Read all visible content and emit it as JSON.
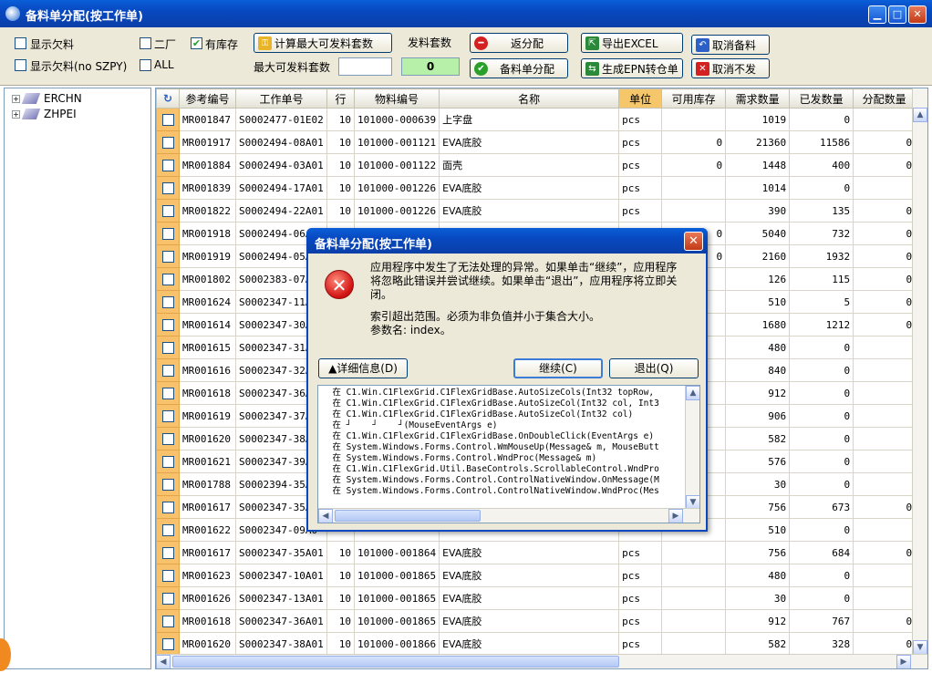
{
  "window": {
    "title": "备料单分配(按工作单)"
  },
  "controls": {
    "show_shortage": "显示欠料",
    "show_shortage_no_szpy": "显示欠料(no SZPY)",
    "factory2": "二厂",
    "all": "ALL",
    "in_stock": "有库存",
    "calc_max": "计算最大可发料套数",
    "issue_sets_label": "发料套数",
    "max_sets_label": "最大可发料套数",
    "max_sets_value": "",
    "issue_sets_value": "0",
    "return_alloc": "返分配",
    "material_alloc": "备料单分配",
    "export_excel": "导出EXCEL",
    "gen_epn": "生成EPN转仓单",
    "cancel_material": "取消备料",
    "cancel_issue": "取消不发"
  },
  "tree": [
    {
      "label": "ERCHN"
    },
    {
      "label": "ZHPEI"
    }
  ],
  "grid": {
    "headers": [
      "参考编号",
      "工作单号",
      "行",
      "物料编号",
      "名称",
      "单位",
      "可用库存",
      "需求数量",
      "已发数量",
      "分配数量"
    ],
    "rows": [
      [
        "MR001847",
        "S0002477-01E02",
        "10",
        "101000-000639",
        "上字盘",
        "pcs",
        "",
        "1019",
        "0",
        ""
      ],
      [
        "MR001917",
        "S0002494-08A01",
        "10",
        "101000-001121",
        "EVA底胶",
        "pcs",
        "0",
        "21360",
        "11586",
        "0"
      ],
      [
        "MR001884",
        "S0002494-03A01",
        "10",
        "101000-001122",
        "面壳",
        "pcs",
        "0",
        "1448",
        "400",
        "0"
      ],
      [
        "MR001839",
        "S0002494-17A01",
        "10",
        "101000-001226",
        "EVA底胶",
        "pcs",
        "",
        "1014",
        "0",
        ""
      ],
      [
        "MR001822",
        "S0002494-22A01",
        "10",
        "101000-001226",
        "EVA底胶",
        "pcs",
        "",
        "390",
        "135",
        "0"
      ],
      [
        "MR001918",
        "S0002494-06A0",
        "",
        "",
        "",
        "",
        "0",
        "5040",
        "732",
        "0"
      ],
      [
        "MR001919",
        "S0002494-05A0",
        "",
        "",
        "",
        "",
        "0",
        "2160",
        "1932",
        "0"
      ],
      [
        "MR001802",
        "S0002383-07A0",
        "",
        "",
        "",
        "",
        "",
        "126",
        "115",
        "0"
      ],
      [
        "MR001624",
        "S0002347-11A0",
        "",
        "",
        "",
        "",
        "",
        "510",
        "5",
        "0"
      ],
      [
        "MR001614",
        "S0002347-30A0",
        "",
        "",
        "",
        "",
        "",
        "1680",
        "1212",
        "0"
      ],
      [
        "MR001615",
        "S0002347-31A0",
        "",
        "",
        "",
        "",
        "",
        "480",
        "0",
        ""
      ],
      [
        "MR001616",
        "S0002347-32A0",
        "",
        "",
        "",
        "",
        "",
        "840",
        "0",
        ""
      ],
      [
        "MR001618",
        "S0002347-36A0",
        "",
        "",
        "",
        "",
        "",
        "912",
        "0",
        ""
      ],
      [
        "MR001619",
        "S0002347-37A0",
        "",
        "",
        "",
        "",
        "",
        "906",
        "0",
        ""
      ],
      [
        "MR001620",
        "S0002347-38A0",
        "",
        "",
        "",
        "",
        "",
        "582",
        "0",
        ""
      ],
      [
        "MR001621",
        "S0002347-39A0",
        "",
        "",
        "",
        "",
        "",
        "576",
        "0",
        ""
      ],
      [
        "MR001788",
        "S0002394-35A0",
        "",
        "",
        "",
        "",
        "",
        "30",
        "0",
        ""
      ],
      [
        "MR001617",
        "S0002347-35A0",
        "",
        "",
        "",
        "",
        "",
        "756",
        "673",
        "0"
      ],
      [
        "MR001622",
        "S0002347-09A0",
        "",
        "",
        "",
        "",
        "",
        "510",
        "0",
        ""
      ],
      [
        "MR001617",
        "S0002347-35A01",
        "10",
        "101000-001864",
        "EVA底胶",
        "pcs",
        "",
        "756",
        "684",
        "0"
      ],
      [
        "MR001623",
        "S0002347-10A01",
        "10",
        "101000-001865",
        "EVA底胶",
        "pcs",
        "",
        "480",
        "0",
        ""
      ],
      [
        "MR001626",
        "S0002347-13A01",
        "10",
        "101000-001865",
        "EVA底胶",
        "pcs",
        "",
        "30",
        "0",
        ""
      ],
      [
        "MR001618",
        "S0002347-36A01",
        "10",
        "101000-001865",
        "EVA底胶",
        "pcs",
        "",
        "912",
        "767",
        "0"
      ],
      [
        "MR001620",
        "S0002347-38A01",
        "10",
        "101000-001866",
        "EVA底胶",
        "pcs",
        "",
        "582",
        "328",
        "0"
      ]
    ]
  },
  "dialog": {
    "title": "备料单分配(按工作单)",
    "message1": "应用程序中发生了无法处理的异常。如果单击“继续”，应用程序将忽略此错误并尝试继续。如果单击“退出”，应用程序将立即关闭。",
    "message2": "索引超出范围。必须为非负值并小于集合大小。",
    "message3": "参数名: index。",
    "details_btn": "▲详细信息(D)",
    "continue_btn": "继续(C)",
    "quit_btn": "退出(Q)",
    "stack": "  在 C1.Win.C1FlexGrid.C1FlexGridBase.AutoSizeCols(Int32 topRow,\n  在 C1.Win.C1FlexGrid.C1FlexGridBase.AutoSizeCol(Int32 col, Int3\n  在 C1.Win.C1FlexGrid.C1FlexGridBase.AutoSizeCol(Int32 col)\n  在 ┘    ┘    ┘(MouseEventArgs e)\n  在 C1.Win.C1FlexGrid.C1FlexGridBase.OnDoubleClick(EventArgs e)\n  在 System.Windows.Forms.Control.WmMouseUp(Message& m, MouseButt\n  在 System.Windows.Forms.Control.WndProc(Message& m)\n  在 C1.Win.C1FlexGrid.Util.BaseControls.ScrollableControl.WndPro\n  在 System.Windows.Forms.Control.ControlNativeWindow.OnMessage(M\n  在 System.Windows.Forms.Control.ControlNativeWindow.WndProc(Mes"
  }
}
